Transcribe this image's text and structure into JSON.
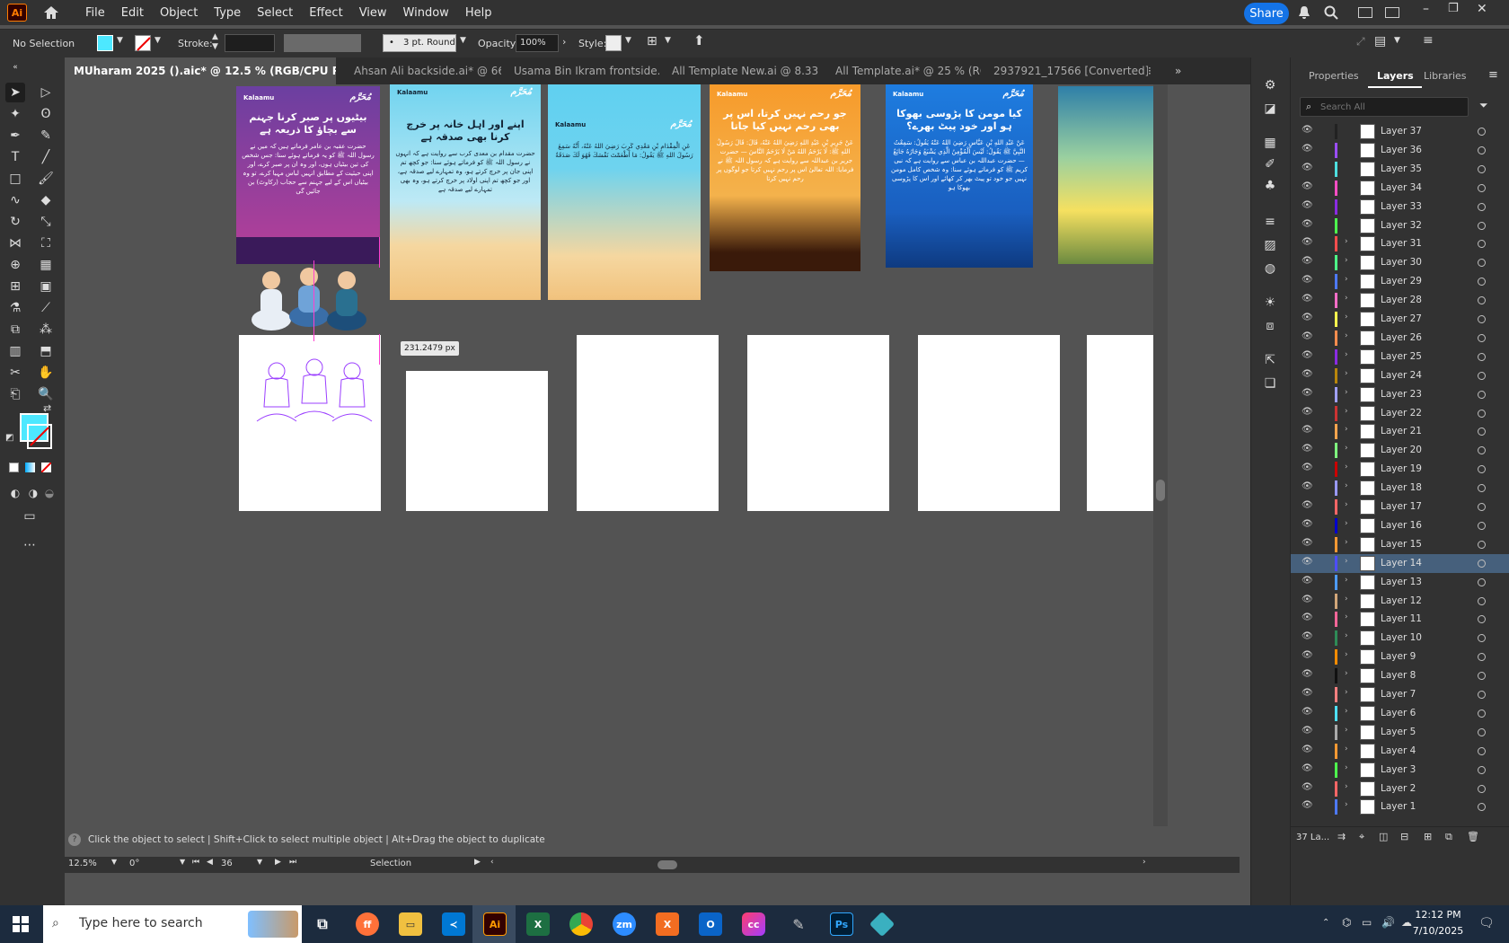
{
  "app": {
    "logo": "Ai"
  },
  "menu": [
    "File",
    "Edit",
    "Object",
    "Type",
    "Select",
    "Effect",
    "View",
    "Window",
    "Help"
  ],
  "share_label": "Share",
  "control": {
    "selection": "No Selection",
    "stroke_label": "Stroke:",
    "brush": "3 pt. Round",
    "opacity_label": "Opacity:",
    "opacity_value": "100%",
    "style_label": "Style:"
  },
  "tabs": [
    {
      "label": "MUharam 2025 ().aic* @ 12.5 % (RGB/CPU Preview)",
      "active": true
    },
    {
      "label": "Ahsan Ali backside.ai* @ 66..."
    },
    {
      "label": "Usama Bin Ikram frontside.ai"
    },
    {
      "label": "All Template New.ai @ 8.33 ..."
    },
    {
      "label": "All Template.ai* @ 25 % (RG..."
    },
    {
      "label": "2937921_17566 [Converted].eps*"
    }
  ],
  "panel": {
    "tabs": [
      "Properties",
      "Layers",
      "Libraries"
    ],
    "search_placeholder": "Search All",
    "layers": [
      {
        "name": "Layer 37",
        "color": "#222222"
      },
      {
        "name": "Layer 36",
        "color": "#9b4dff"
      },
      {
        "name": "Layer 35",
        "color": "#4de0e0"
      },
      {
        "name": "Layer 34",
        "color": "#ff4dc4"
      },
      {
        "name": "Layer 33",
        "color": "#8a2be2"
      },
      {
        "name": "Layer 32",
        "color": "#4dff4d"
      },
      {
        "name": "Layer 31",
        "color": "#ff4d4d"
      },
      {
        "name": "Layer 30",
        "color": "#4dff88"
      },
      {
        "name": "Layer 29",
        "color": "#4d79ff"
      },
      {
        "name": "Layer 28",
        "color": "#ff6ec7"
      },
      {
        "name": "Layer 27",
        "color": "#ffff4d"
      },
      {
        "name": "Layer 26",
        "color": "#ff8c4d"
      },
      {
        "name": "Layer 25",
        "color": "#8a2be2"
      },
      {
        "name": "Layer 24",
        "color": "#b8860b"
      },
      {
        "name": "Layer 23",
        "color": "#a0a0ff"
      },
      {
        "name": "Layer 22",
        "color": "#cc3333"
      },
      {
        "name": "Layer 21",
        "color": "#ffa54d"
      },
      {
        "name": "Layer 20",
        "color": "#7fff7f"
      },
      {
        "name": "Layer 19",
        "color": "#cc0000"
      },
      {
        "name": "Layer 18",
        "color": "#9999ff"
      },
      {
        "name": "Layer 17",
        "color": "#ff6666"
      },
      {
        "name": "Layer 16",
        "color": "#0000cc"
      },
      {
        "name": "Layer 15",
        "color": "#ff9933"
      },
      {
        "name": "Layer 14",
        "color": "#4d4dff",
        "selected": true
      },
      {
        "name": "Layer 13",
        "color": "#4d9bff"
      },
      {
        "name": "Layer 12",
        "color": "#d2a679"
      },
      {
        "name": "Layer 11",
        "color": "#ff6699"
      },
      {
        "name": "Layer 10",
        "color": "#2e8b57"
      },
      {
        "name": "Layer 9",
        "color": "#ff8c00"
      },
      {
        "name": "Layer 8",
        "color": "#111111"
      },
      {
        "name": "Layer 7",
        "color": "#ff8080"
      },
      {
        "name": "Layer 6",
        "color": "#4de0ff"
      },
      {
        "name": "Layer 5",
        "color": "#aaaaaa"
      },
      {
        "name": "Layer 4",
        "color": "#ff9933"
      },
      {
        "name": "Layer 3",
        "color": "#4dff4d"
      },
      {
        "name": "Layer 2",
        "color": "#ff6666"
      },
      {
        "name": "Layer 1",
        "color": "#4d79ff"
      }
    ],
    "footer_count": "37 La..."
  },
  "canvas": {
    "measure_label": "231.2479 px",
    "artboards": [
      {
        "brand": "Kalaamu",
        "badge": "مُحَرَّم",
        "title": "بیٹیوں پر صبر کرنا جہنم سے بچاؤ کا ذریعہ ہے",
        "body": "حضرت عقبہ بن عامر فرماتے ہیں کہ میں نے رسول اللہ ﷺ کو یہ فرماتے ہوئے سنا: جس شخص کی تین بیٹیاں ہوں، اور وہ ان پر صبر کرے، اور اپنی حیثیت کے مطابق انہیں لباس مہیا کرے، تو وہ بیٹیاں اس کے لیے جہنم سے حجاب (رکاوٹ) بن جائیں گی"
      },
      {
        "brand": "Kalaamu",
        "badge": "مُحَرَّم",
        "title": "اپنے اور اہل خانہ پر خرچ کرنا بھی صدقہ ہے",
        "body": "حضرت مقدام بن معدی کرب سے روایت ہے کہ انہوں نے رسول اللہ ﷺ کو فرماتے ہوئے سنا: جو کچھ تم اپنی جان پر خرچ کرتے ہو، وہ تمہارے لیے صدقہ ہے، اور جو کچھ تم اپنی اولاد پر خرچ کرتے ہو، وہ بھی تمہارے لیے صدقہ ہے"
      },
      {
        "brand": "Kalaamu",
        "badge": "مُحَرَّم",
        "title": "",
        "body": "عَنِ الْمِقْدَامِ بْنِ مَعْدِي كَرِبَ رَضِيَ اللهُ عَنْهُ، أَنَّهُ سَمِعَ رَسُولَ اللهِ ﷺ يَقُولُ: مَا أَطْعَمْتَ نَفْسَكَ فَهُوَ لَكَ صَدَقَةٌ"
      },
      {
        "brand": "Kalaamu",
        "badge": "مُحَرَّم",
        "title": "جو رحم نہیں کرتا، اس پر بھی رحم نہیں کیا جاتا",
        "body": "عَنْ جَرِيرِ بْنِ عَبْدِ اللهِ رَضِيَ اللهُ عَنْهُ، قَالَ: قَالَ رَسُولُ اللهِ ﷺ: لَا يَرْحَمُ اللهُ مَنْ لَا يَرْحَمُ النَّاسَ — حضرت جریر بن عبداللہ سے روایت ہے کہ رسول اللہ ﷺ نے فرمایا: اللہ تعالیٰ اس پر رحم نہیں کرتا جو لوگوں پر رحم نہیں کرتا"
      },
      {
        "brand": "Kalaamu",
        "badge": "مُحَرَّم",
        "title": "کیا مومن کا پڑوسی بھوکا ہو اور خود پیٹ بھرے؟",
        "body": "عَنْ عَبْدِ اللهِ بْنِ عَبَّاسٍ رَضِيَ اللهُ عَنْهُ يَقُولُ: سَمِعْتُ النَّبِيَّ ﷺ يَقُولُ: لَيْسَ الْمُؤْمِنُ الَّذِي يَشْبَعُ وَجَارُهُ جَائِعٌ — حضرت عبداللہ بن عباس سے روایت ہے کہ نبی کریم ﷺ کو فرماتے ہوئے سنا: وہ شخص کامل مومن نہیں جو خود تو پیٹ بھر کر کھائے اور اس کا پڑوسی بھوکا ہو"
      }
    ]
  },
  "status": {
    "hint": "Click the object to select  |  Shift+Click to select multiple object  |  Alt+Drag the object to duplicate",
    "zoom": "12.5%",
    "rotate": "0°",
    "artboard_num": "36",
    "mode": "Selection"
  },
  "taskbar": {
    "search_placeholder": "Type here to search",
    "time": "12:12 PM",
    "date": "7/10/2025"
  }
}
